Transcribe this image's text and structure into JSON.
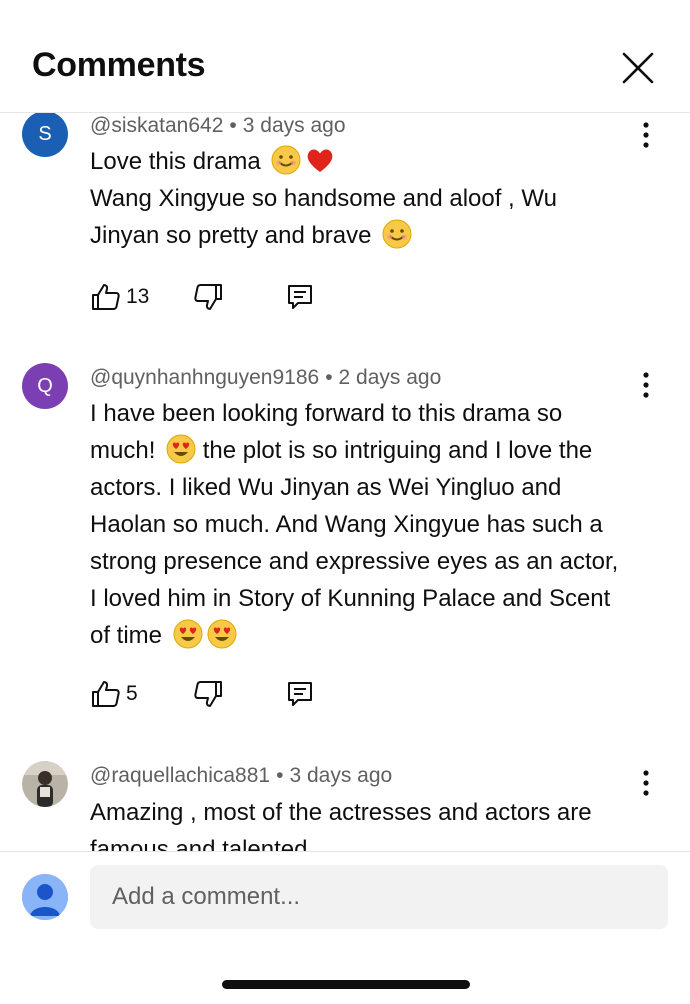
{
  "header": {
    "title": "Comments",
    "close_icon": "close-icon"
  },
  "colors": {
    "avatar_s": "#1a5fb4",
    "avatar_q": "#7b3fb3",
    "self_avatar": "#8ab4f8",
    "meta": "#606060"
  },
  "comments": [
    {
      "initial": "S",
      "handle": "@siskatan642",
      "separator": "•",
      "time": "3 days ago",
      "lines": [
        "Love this drama",
        "Wang Xingyue so handsome and aloof , Wu Jinyan so pretty and brave"
      ],
      "emojis": [
        "smiling-face",
        "red-heart",
        "smiling-face"
      ],
      "likes": "13"
    },
    {
      "initial": "Q",
      "handle": "@quynhanhnguyen9186",
      "separator": "•",
      "time": "2 days ago",
      "text_a": "I have been looking forward to this drama so much!",
      "text_b": "the plot is so intriguing and I love the actors. I liked Wu Jinyan as Wei Yingluo and Haolan so much. And Wang Xingyue has such a strong presence and expressive eyes as an actor, I loved him in Story of Kunning Palace and Scent of time",
      "emojis": [
        "heart-eyes-face",
        "heart-eyes-face",
        "heart-eyes-face"
      ],
      "likes": "5"
    },
    {
      "initial": "",
      "handle": "@raquellachica881",
      "separator": "•",
      "time": "3 days ago",
      "text": "Amazing , most of the actresses and actors are famous and talented"
    }
  ],
  "composer": {
    "placeholder": "Add a comment..."
  }
}
